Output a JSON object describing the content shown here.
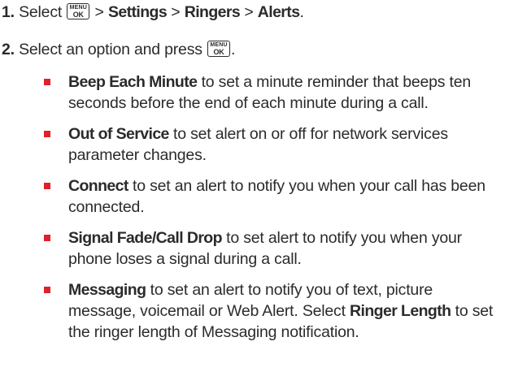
{
  "step1": {
    "number": "1.",
    "select_word": "Select",
    "key_top": "MENU",
    "key_bottom": "OK",
    "sep1": ">",
    "path1": "Settings",
    "sep2": ">",
    "path2": "Ringers",
    "sep3": ">",
    "path3": "Alerts",
    "end": "."
  },
  "step2": {
    "number": "2.",
    "text": "Select an option and press",
    "key_top": "MENU",
    "key_bottom": "OK",
    "end": "."
  },
  "bullets": [
    {
      "term": "Beep Each Minute",
      "text": " to set a minute reminder that beeps ten seconds before the end of each minute during a call."
    },
    {
      "term": "Out of Service",
      "text": " to set alert on or off for network services parameter changes."
    },
    {
      "term": "Connect",
      "text": " to set an alert to notify you when your call has been connected."
    },
    {
      "term": "Signal Fade/Call Drop",
      "text": " to set alert to notify you when your phone loses a signal during a call."
    },
    {
      "term": "Messaging",
      "text": " to set an alert to notify you of text, picture message, voicemail or Web Alert. Select ",
      "term2": "Ringer Length",
      "text2": " to set the ringer length of Messaging notification."
    }
  ],
  "colors": {
    "bullet": "#e0202a",
    "text": "#2b2b2b"
  }
}
